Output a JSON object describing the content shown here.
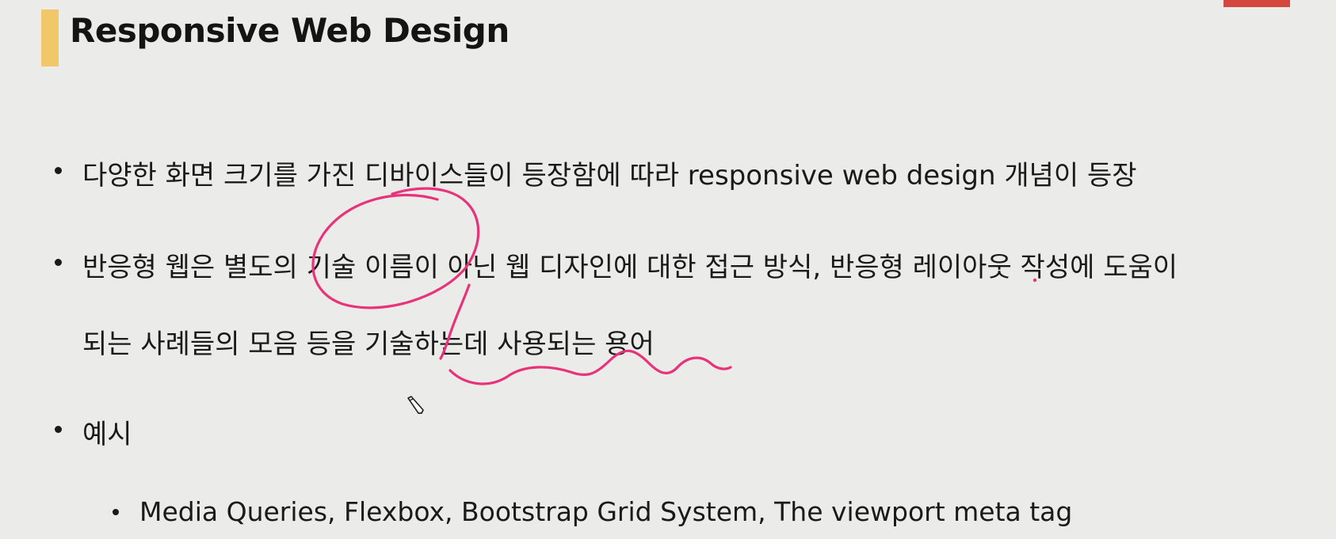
{
  "slide": {
    "title": "Responsive Web Design",
    "colors": {
      "title_accent": "#f0c869",
      "annotation": "#e8337a",
      "corner_tab": "#d4473e"
    },
    "bullets": [
      {
        "text": "다양한 화면 크기를 가진 디바이스들이 등장함에 따라 responsive web design 개념이 등장"
      },
      {
        "line1": "반응형 웹은 별도의 기술 이름이 아닌 웹 디자인에 대한 접근 방식, 반응형 레이아웃 작성에 도움이",
        "line2": "되는 사례들의 모음 등을 기술하는데 사용되는 용어"
      },
      {
        "text": "예시"
      }
    ],
    "sub_bullets": [
      {
        "text": "Media Queries, Flexbox, Bootstrap Grid System, The viewport meta tag"
      }
    ],
    "cursor_icon": "pencil-cursor-icon"
  }
}
